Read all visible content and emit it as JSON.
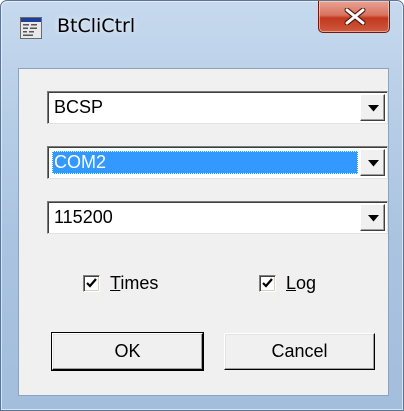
{
  "window": {
    "title": "BtCliCtrl",
    "app_icon": "app-icon",
    "close_icon": "close-x-icon"
  },
  "combos": [
    {
      "value": "BCSP"
    },
    {
      "value": "COM2"
    },
    {
      "value": "115200"
    }
  ],
  "checkboxes": {
    "times": {
      "label_first": "T",
      "label_rest": "imes",
      "checked": true
    },
    "log": {
      "label_first": "L",
      "label_rest": "og",
      "checked": true
    }
  },
  "buttons": {
    "ok": "OK",
    "cancel": "Cancel"
  },
  "colors": {
    "selection": "#3399ff",
    "close": "#c1391f",
    "dialog": "#f0f0f0"
  }
}
